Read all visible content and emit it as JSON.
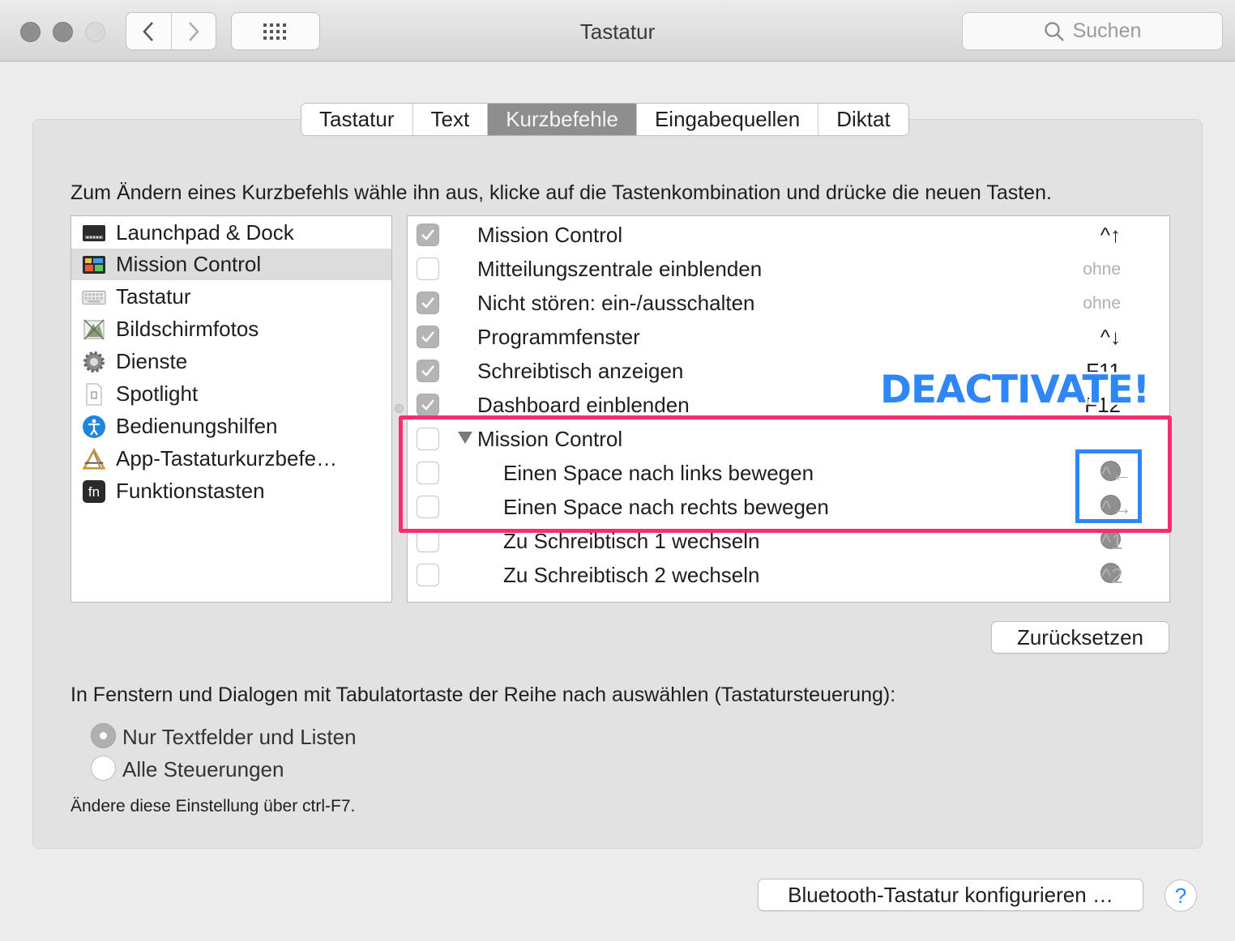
{
  "window": {
    "title": "Tastatur"
  },
  "search": {
    "placeholder": "Suchen"
  },
  "tabs": [
    {
      "label": "Tastatur",
      "active": false
    },
    {
      "label": "Text",
      "active": false
    },
    {
      "label": "Kurzbefehle",
      "active": true
    },
    {
      "label": "Eingabequellen",
      "active": false
    },
    {
      "label": "Diktat",
      "active": false
    }
  ],
  "instruction": "Zum Ändern eines Kurzbefehls wähle ihn aus, klicke auf die Tastenkombination und drücke die neuen Tasten.",
  "categories": [
    {
      "label": "Launchpad & Dock",
      "icon": "launchpad-dock-icon"
    },
    {
      "label": "Mission Control",
      "icon": "mission-control-icon",
      "selected": true
    },
    {
      "label": "Tastatur",
      "icon": "keyboard-icon"
    },
    {
      "label": "Bildschirmfotos",
      "icon": "screenshot-icon"
    },
    {
      "label": "Dienste",
      "icon": "services-gear-icon"
    },
    {
      "label": "Spotlight",
      "icon": "spotlight-document-icon"
    },
    {
      "label": "Bedienungshilfen",
      "icon": "accessibility-icon"
    },
    {
      "label": "App-Tastaturkurzbefe…",
      "icon": "app-shortcuts-icon"
    },
    {
      "label": "Funktionstasten",
      "icon": "fn-key-icon"
    }
  ],
  "shortcuts": [
    {
      "label": "Mission Control",
      "key": "^↑",
      "checked": true
    },
    {
      "label": "Mitteilungszentrale einblenden",
      "key": "ohne",
      "checked": false
    },
    {
      "label": "Nicht stören: ein-/ausschalten",
      "key": "ohne",
      "checked": true
    },
    {
      "label": "Programmfenster",
      "key": "^↓",
      "checked": true
    },
    {
      "label": "Schreibtisch anzeigen",
      "key": "F11",
      "checked": true
    },
    {
      "label": "Dashboard einblenden",
      "key": "F12",
      "checked": true
    },
    {
      "label": "Mission Control",
      "key": "",
      "checked": false,
      "group": true
    },
    {
      "label": "Einen Space nach links bewegen",
      "key": "^←",
      "checked": false
    },
    {
      "label": "Einen Space nach rechts bewegen",
      "key": "^→",
      "checked": false
    },
    {
      "label": "Zu Schreibtisch 1 wechseln",
      "key": "^1",
      "checked": false
    },
    {
      "label": "Zu Schreibtisch 2 wechseln",
      "key": "^2",
      "checked": false
    }
  ],
  "annotation": {
    "text": "DEACTIVATE!",
    "pink": "#f72d73",
    "blue": "#2f86f7"
  },
  "reset_button": "Zurücksetzen",
  "tab_navigation": {
    "heading": "In Fenstern und Dialogen mit Tabulatortaste der Reihe nach auswählen (Tastatursteuerung):",
    "options": [
      {
        "label": "Nur Textfelder und Listen",
        "selected": true
      },
      {
        "label": "Alle Steuerungen",
        "selected": false
      }
    ],
    "note": "Ändere diese Einstellung über ctrl-F7."
  },
  "bluetooth_button": "Bluetooth-Tastatur konfigurieren …",
  "help_button": "?"
}
